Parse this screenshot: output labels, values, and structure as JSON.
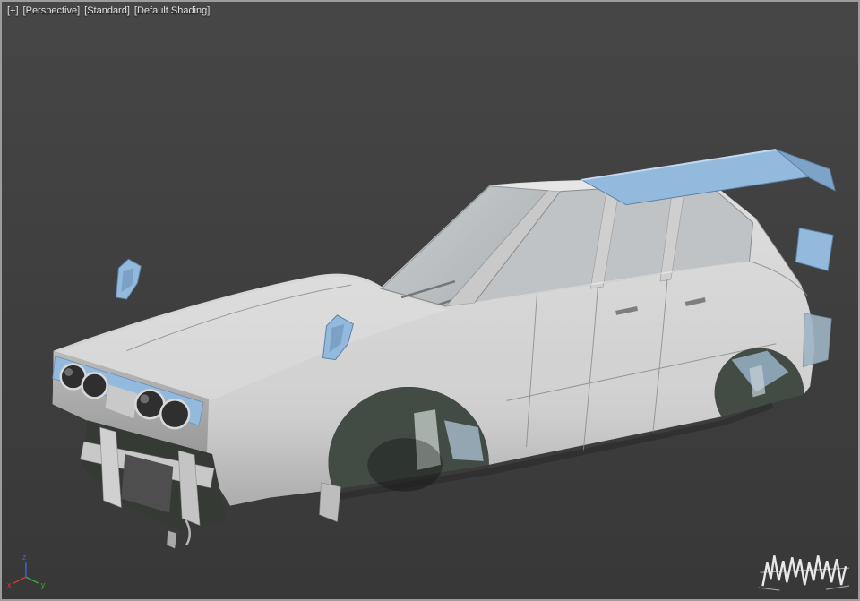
{
  "viewport": {
    "label_general": "[+]",
    "label_pov": "[Perspective]",
    "label_preset": "[Standard]",
    "label_shading": "[Default Shading]"
  },
  "scene": {
    "model": "hatchback-car-body-shell",
    "accents": "blue-accessory-parts"
  },
  "axis_gizmo": {
    "x": "x",
    "y": "y",
    "z": "z"
  },
  "watermark": {
    "icon": "graffiti-signature"
  },
  "colors": {
    "background_top": "#464646",
    "background_bottom": "#383838",
    "body": "#d2d2d2",
    "glass": "#bfc3c5",
    "accent_blue": "#93b9dd",
    "accent_blue_dark": "#7da3c9",
    "arch_interior": "#434b45",
    "frame_light": "#c8c8c8",
    "label_text": "#e4e4e4",
    "axis_x": "#cc3a2e",
    "axis_y": "#3aa43a",
    "axis_z": "#3a62d8",
    "watermark_white": "#f2f2f2"
  }
}
